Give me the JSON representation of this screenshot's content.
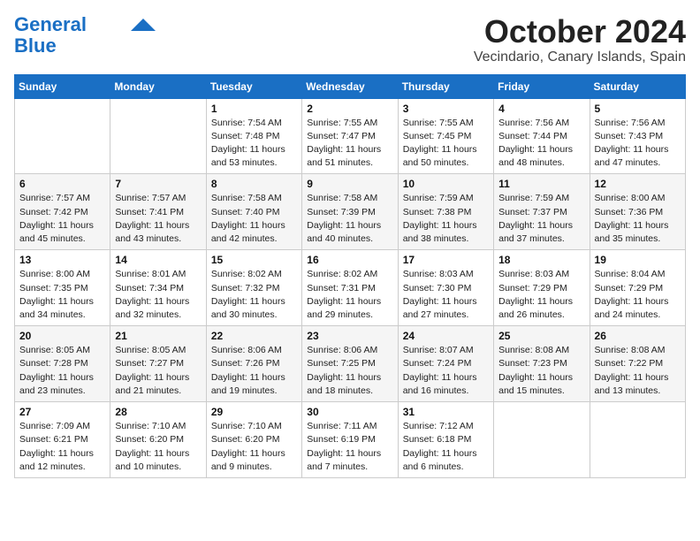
{
  "header": {
    "logo_line1": "General",
    "logo_line2": "Blue",
    "month": "October 2024",
    "location": "Vecindario, Canary Islands, Spain"
  },
  "weekdays": [
    "Sunday",
    "Monday",
    "Tuesday",
    "Wednesday",
    "Thursday",
    "Friday",
    "Saturday"
  ],
  "weeks": [
    [
      {
        "day": "",
        "info": ""
      },
      {
        "day": "",
        "info": ""
      },
      {
        "day": "1",
        "info": "Sunrise: 7:54 AM\nSunset: 7:48 PM\nDaylight: 11 hours\nand 53 minutes."
      },
      {
        "day": "2",
        "info": "Sunrise: 7:55 AM\nSunset: 7:47 PM\nDaylight: 11 hours\nand 51 minutes."
      },
      {
        "day": "3",
        "info": "Sunrise: 7:55 AM\nSunset: 7:45 PM\nDaylight: 11 hours\nand 50 minutes."
      },
      {
        "day": "4",
        "info": "Sunrise: 7:56 AM\nSunset: 7:44 PM\nDaylight: 11 hours\nand 48 minutes."
      },
      {
        "day": "5",
        "info": "Sunrise: 7:56 AM\nSunset: 7:43 PM\nDaylight: 11 hours\nand 47 minutes."
      }
    ],
    [
      {
        "day": "6",
        "info": "Sunrise: 7:57 AM\nSunset: 7:42 PM\nDaylight: 11 hours\nand 45 minutes."
      },
      {
        "day": "7",
        "info": "Sunrise: 7:57 AM\nSunset: 7:41 PM\nDaylight: 11 hours\nand 43 minutes."
      },
      {
        "day": "8",
        "info": "Sunrise: 7:58 AM\nSunset: 7:40 PM\nDaylight: 11 hours\nand 42 minutes."
      },
      {
        "day": "9",
        "info": "Sunrise: 7:58 AM\nSunset: 7:39 PM\nDaylight: 11 hours\nand 40 minutes."
      },
      {
        "day": "10",
        "info": "Sunrise: 7:59 AM\nSunset: 7:38 PM\nDaylight: 11 hours\nand 38 minutes."
      },
      {
        "day": "11",
        "info": "Sunrise: 7:59 AM\nSunset: 7:37 PM\nDaylight: 11 hours\nand 37 minutes."
      },
      {
        "day": "12",
        "info": "Sunrise: 8:00 AM\nSunset: 7:36 PM\nDaylight: 11 hours\nand 35 minutes."
      }
    ],
    [
      {
        "day": "13",
        "info": "Sunrise: 8:00 AM\nSunset: 7:35 PM\nDaylight: 11 hours\nand 34 minutes."
      },
      {
        "day": "14",
        "info": "Sunrise: 8:01 AM\nSunset: 7:34 PM\nDaylight: 11 hours\nand 32 minutes."
      },
      {
        "day": "15",
        "info": "Sunrise: 8:02 AM\nSunset: 7:32 PM\nDaylight: 11 hours\nand 30 minutes."
      },
      {
        "day": "16",
        "info": "Sunrise: 8:02 AM\nSunset: 7:31 PM\nDaylight: 11 hours\nand 29 minutes."
      },
      {
        "day": "17",
        "info": "Sunrise: 8:03 AM\nSunset: 7:30 PM\nDaylight: 11 hours\nand 27 minutes."
      },
      {
        "day": "18",
        "info": "Sunrise: 8:03 AM\nSunset: 7:29 PM\nDaylight: 11 hours\nand 26 minutes."
      },
      {
        "day": "19",
        "info": "Sunrise: 8:04 AM\nSunset: 7:29 PM\nDaylight: 11 hours\nand 24 minutes."
      }
    ],
    [
      {
        "day": "20",
        "info": "Sunrise: 8:05 AM\nSunset: 7:28 PM\nDaylight: 11 hours\nand 23 minutes."
      },
      {
        "day": "21",
        "info": "Sunrise: 8:05 AM\nSunset: 7:27 PM\nDaylight: 11 hours\nand 21 minutes."
      },
      {
        "day": "22",
        "info": "Sunrise: 8:06 AM\nSunset: 7:26 PM\nDaylight: 11 hours\nand 19 minutes."
      },
      {
        "day": "23",
        "info": "Sunrise: 8:06 AM\nSunset: 7:25 PM\nDaylight: 11 hours\nand 18 minutes."
      },
      {
        "day": "24",
        "info": "Sunrise: 8:07 AM\nSunset: 7:24 PM\nDaylight: 11 hours\nand 16 minutes."
      },
      {
        "day": "25",
        "info": "Sunrise: 8:08 AM\nSunset: 7:23 PM\nDaylight: 11 hours\nand 15 minutes."
      },
      {
        "day": "26",
        "info": "Sunrise: 8:08 AM\nSunset: 7:22 PM\nDaylight: 11 hours\nand 13 minutes."
      }
    ],
    [
      {
        "day": "27",
        "info": "Sunrise: 7:09 AM\nSunset: 6:21 PM\nDaylight: 11 hours\nand 12 minutes."
      },
      {
        "day": "28",
        "info": "Sunrise: 7:10 AM\nSunset: 6:20 PM\nDaylight: 11 hours\nand 10 minutes."
      },
      {
        "day": "29",
        "info": "Sunrise: 7:10 AM\nSunset: 6:20 PM\nDaylight: 11 hours\nand 9 minutes."
      },
      {
        "day": "30",
        "info": "Sunrise: 7:11 AM\nSunset: 6:19 PM\nDaylight: 11 hours\nand 7 minutes."
      },
      {
        "day": "31",
        "info": "Sunrise: 7:12 AM\nSunset: 6:18 PM\nDaylight: 11 hours\nand 6 minutes."
      },
      {
        "day": "",
        "info": ""
      },
      {
        "day": "",
        "info": ""
      }
    ]
  ]
}
